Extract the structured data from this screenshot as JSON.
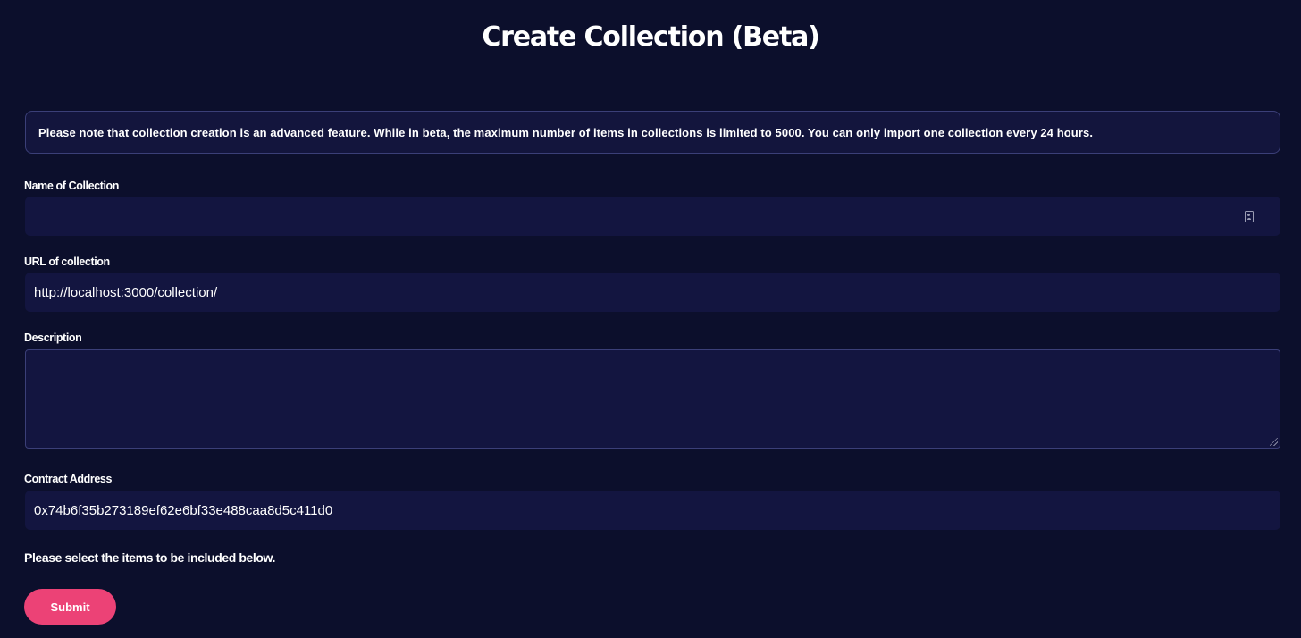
{
  "page": {
    "title": "Create Collection (Beta)"
  },
  "notice": {
    "text": "Please note that collection creation is an advanced feature. While in beta, the maximum number of items in collections is limited to 5000. You can only import one collection every 24 hours."
  },
  "form": {
    "name": {
      "label": "Name of Collection",
      "value": "",
      "icon": "contact-card-icon"
    },
    "url": {
      "label": "URL of collection",
      "value": "http://localhost:3000/collection/"
    },
    "description": {
      "label": "Description",
      "value": ""
    },
    "contract_address": {
      "label": "Contract Address",
      "value": "0x74b6f35b273189ef62e6bf33e488caa8d5c411d0"
    },
    "instruction": "Please select the items to be included below.",
    "submit_label": "Submit"
  },
  "colors": {
    "background": "#0c0f2c",
    "field_background": "#131540",
    "border": "#3b3f78",
    "accent": "#ec4276"
  }
}
